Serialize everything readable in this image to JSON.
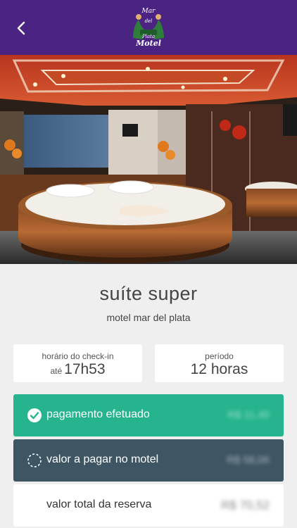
{
  "header": {
    "back_icon": "chevron-left-icon",
    "logo_lines": [
      "Mar",
      "del",
      "Plata",
      "Motel"
    ],
    "bg_color": "#4b2483"
  },
  "suite": {
    "name": "suíte super",
    "motel_name": "motel mar del plata"
  },
  "checkin": {
    "label": "horário do check-in",
    "prefix": "até",
    "time": "17h53"
  },
  "period": {
    "label": "período",
    "value": "12 horas"
  },
  "payment_rows": [
    {
      "label": "pagamento efetuado",
      "amount": "R$ 11,40",
      "icon": "check-circle-icon",
      "color": "#25b48d"
    },
    {
      "label": "valor a pagar no motel",
      "amount": "R$ 58,06",
      "icon": "dashed-circle-icon",
      "color": "#3e5663"
    },
    {
      "label": "valor total da reserva",
      "amount": "R$ 70,52",
      "icon": "",
      "color": "#ffffff"
    }
  ]
}
